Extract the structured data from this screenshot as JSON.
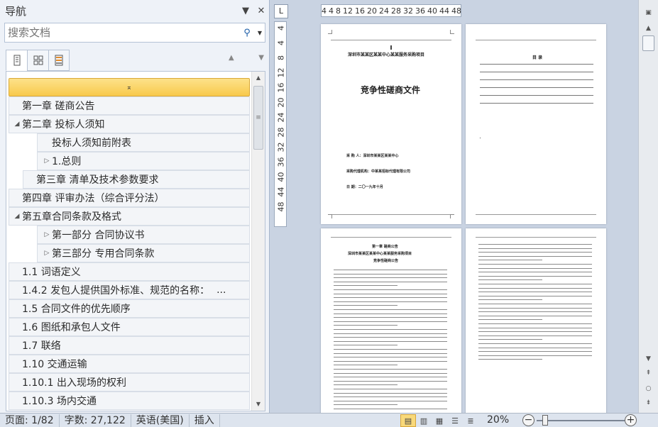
{
  "nav": {
    "title": "导航",
    "search_placeholder": "搜索文档",
    "items": [
      {
        "label": "第一章  磋商公告",
        "indent": 0,
        "toggle": ""
      },
      {
        "label": "第二章 投标人须知",
        "indent": 0,
        "toggle": "◢"
      },
      {
        "label": "投标人须知前附表",
        "indent": 2,
        "toggle": ""
      },
      {
        "label": "1.总则",
        "indent": 2,
        "toggle": "▷"
      },
      {
        "label": "第三章 清单及技术参数要求",
        "indent": 1,
        "toggle": ""
      },
      {
        "label": "第四章 评审办法（综合评分法）",
        "indent": 0,
        "toggle": ""
      },
      {
        "label": "第五章合同条款及格式",
        "indent": 0,
        "toggle": "◢"
      },
      {
        "label": "第一部分 合同协议书",
        "indent": 2,
        "toggle": "▷"
      },
      {
        "label": "第三部分 专用合同条款",
        "indent": 2,
        "toggle": "▷"
      },
      {
        "label": "1.1 词语定义",
        "indent": 0,
        "toggle": ""
      },
      {
        "label": "1.4.2 发包人提供国外标准、规范的名称：",
        "indent": 0,
        "toggle": "",
        "ellipsis": "..."
      },
      {
        "label": "1.5 合同文件的优先顺序",
        "indent": 0,
        "toggle": ""
      },
      {
        "label": "1.6 图纸和承包人文件",
        "indent": 0,
        "toggle": ""
      },
      {
        "label": "1.7 联络",
        "indent": 0,
        "toggle": ""
      },
      {
        "label": "1.10 交通运输",
        "indent": 0,
        "toggle": ""
      },
      {
        "label": "1.10.1 出入现场的权利",
        "indent": 0,
        "toggle": ""
      },
      {
        "label": "1.10.3 场内交通",
        "indent": 0,
        "toggle": ""
      }
    ]
  },
  "ruler": {
    "top_ticks": [
      "4",
      "4",
      "8",
      "12",
      "16",
      "20",
      "24",
      "28",
      "32",
      "36",
      "40",
      "44",
      "48"
    ],
    "left_ticks": [
      "4",
      "4",
      "8",
      "12",
      "16",
      "20",
      "24",
      "28",
      "32",
      "36",
      "40",
      "44",
      "48"
    ],
    "corner": "L"
  },
  "pages": {
    "cover_header": "深圳市某某区某某中心某某服务采购项目",
    "cover_title": "竞争性磋商文件",
    "cover_line1": "采  购  人：深圳市某某区某某中心",
    "cover_line2": "采购代理机构：中某某招标代理有限公司",
    "cover_date": "日      期：二〇一九年十月",
    "toc_title": "目  录",
    "p3_heading": "第一章  磋商公告",
    "p3_sub1": "深圳市某某区某某中心某某服务采购项目",
    "p3_sub2": "竞争性磋商公告"
  },
  "status": {
    "page": "页面: 1/82",
    "words": "字数: 27,122",
    "language": "英语(美国)",
    "mode": "插入",
    "zoom": "20%",
    "zoom_minus": "−",
    "zoom_plus": "+"
  }
}
